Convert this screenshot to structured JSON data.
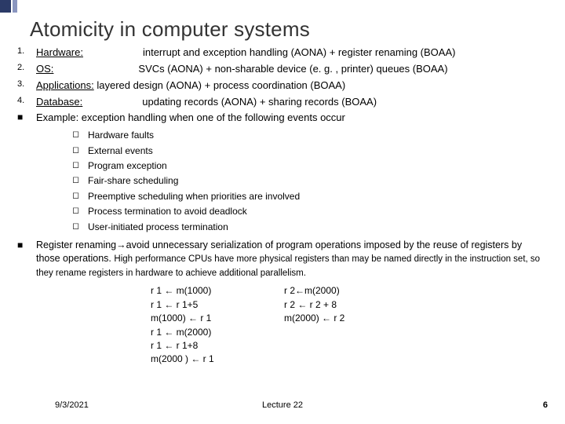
{
  "title": "Atomicity in computer systems",
  "numbered": [
    {
      "n": "1.",
      "label": "Hardware:",
      "text": "interrupt and exception handling (AONA) + register renaming (BOAA)"
    },
    {
      "n": "2.",
      "label": "OS:",
      "text": "SVCs (AONA) + non-sharable device (e. g. , printer)  queues (BOAA)"
    },
    {
      "n": "3.",
      "label": "Applications:",
      "text": "layered design (AONA) + process coordination (BOAA)"
    },
    {
      "n": "4.",
      "label": "Database:",
      "text": "updating records (AONA) + sharing records (BOAA)"
    }
  ],
  "example_intro": "Example: exception handling when one of the following events occur",
  "sub": [
    "Hardware faults",
    "External events",
    "Program exception",
    "Fair-share scheduling",
    "Preemptive scheduling when priorities are involved",
    "Process termination to avoid deadlock",
    "User-initiated process termination"
  ],
  "reg_lead": "Register renaming",
  "reg_arrow": "→",
  "reg_bold": "avoid unnecessary serialization of program operations imposed by the reuse of registers by those operations.",
  "reg_small": "High performance CPUs have more physical registers than may be named directly in the instruction set, so they rename registers in hardware to achieve additional parallelism.",
  "code_col1": [
    "r 1  ←  m(1000)",
    "r 1  ←  r 1+5",
    "m(1000)  ←  r 1",
    "r 1  ←  m(2000)",
    " r 1  ←  r 1+8",
    "m(2000 )  ←  r 1"
  ],
  "code_col2": [
    "",
    "",
    "",
    "r 2←m(2000)",
    "r 2  ←  r 2 + 8",
    "m(2000)  ←  r 2"
  ],
  "footer": {
    "date": "9/3/2021",
    "center": "Lecture 22",
    "page": "6"
  }
}
